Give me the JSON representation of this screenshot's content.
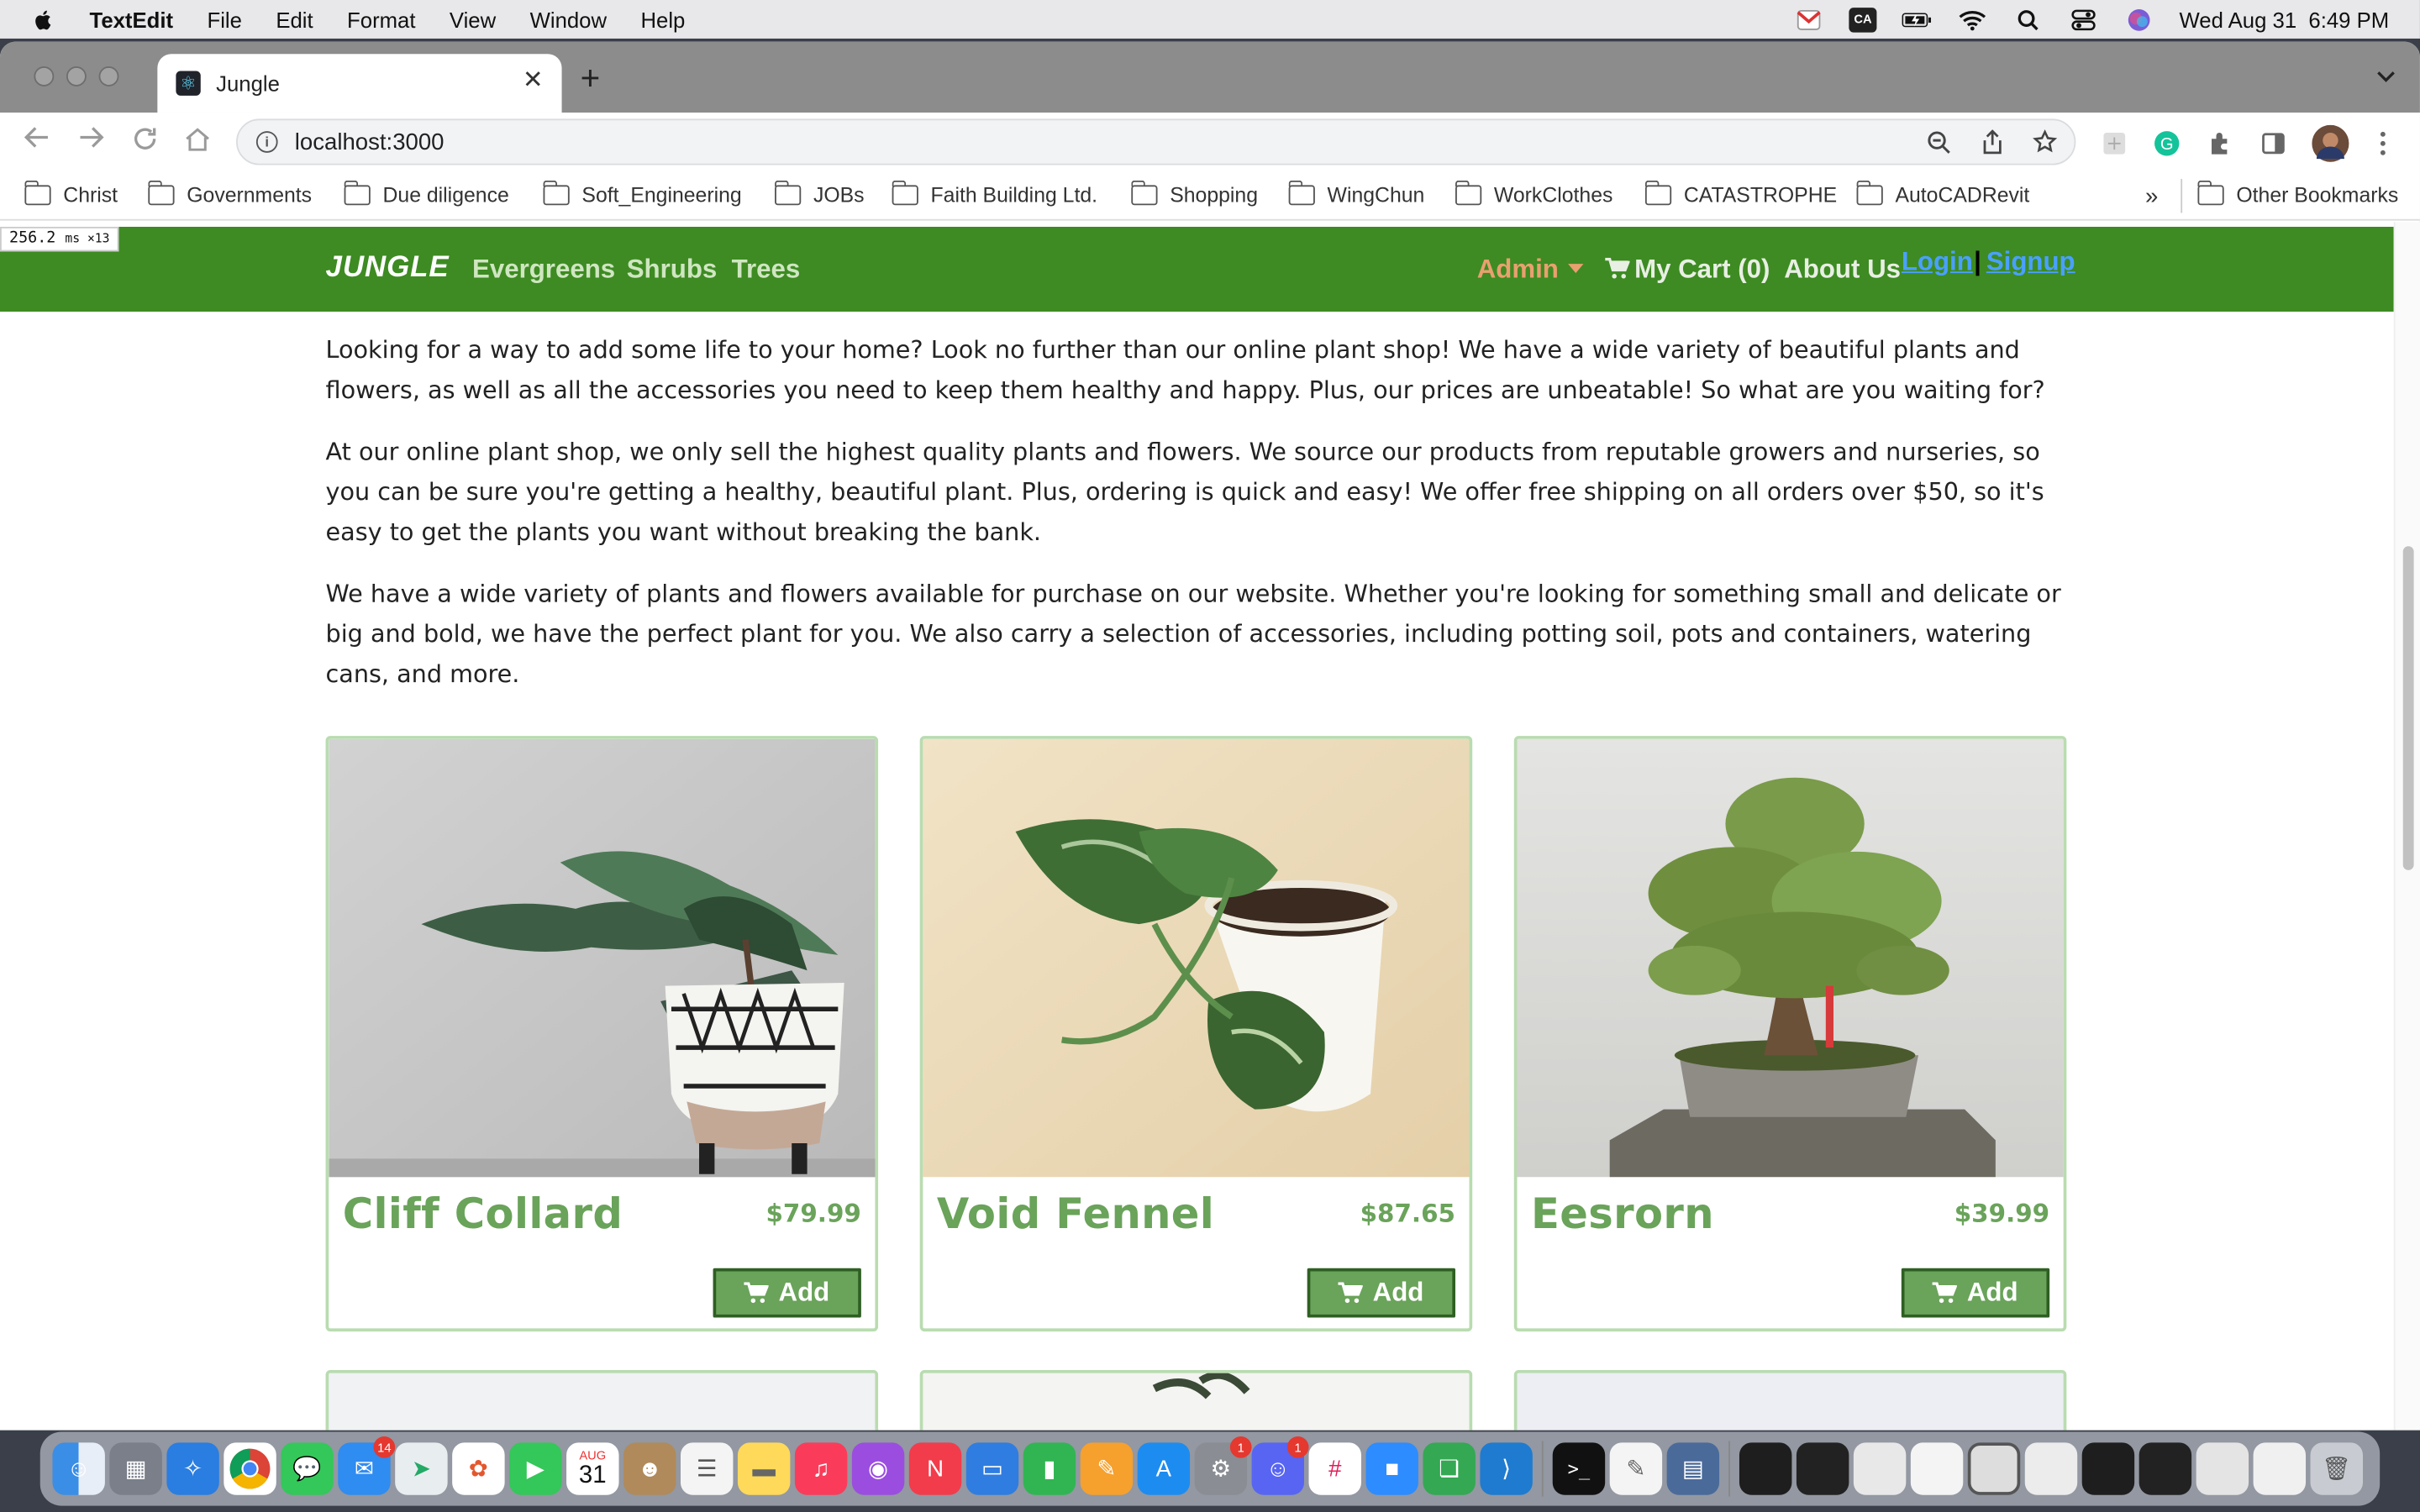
{
  "menubar": {
    "app_name": "TextEdit",
    "items": [
      "File",
      "Edit",
      "Format",
      "View",
      "Window",
      "Help"
    ],
    "status_icons": [
      "gmail-icon",
      "ca-icon",
      "battery-icon",
      "wifi-icon",
      "spotlight-icon",
      "control-center-icon",
      "siri-icon"
    ],
    "ca_label": "CA",
    "clock": "Wed Aug 31  6:49 PM"
  },
  "browser": {
    "tab_title": "Jungle",
    "url": "localhost:3000",
    "bookmarks": [
      "Christ",
      "Governments",
      "Due diligence",
      "Soft_Engineering",
      "JOBs",
      "Faith Building Ltd.",
      "Shopping",
      "WingChun",
      "WorkClothes",
      "CATASTROPHE",
      "AutoCADRevit"
    ],
    "bookmarks_overflow": "»",
    "other_bookmarks": "Other Bookmarks"
  },
  "perf_overlay": {
    "value": "256.2",
    "unit": "ms ×13"
  },
  "site": {
    "brand": "JUNGLE",
    "nav": {
      "evergreens": "Evergreens",
      "shrubs": "Shrubs",
      "trees": "Trees"
    },
    "admin": "Admin",
    "cart": "My Cart (0)",
    "about": "About Us",
    "login": "Login",
    "separator": "|",
    "signup": "Signup",
    "paragraphs": [
      "Looking for a way to add some life to your home? Look no further than our online plant shop! We have a wide variety of beautiful plants and flowers, as well as all the accessories you need to keep them healthy and happy. Plus, our prices are unbeatable! So what are you waiting for?",
      "At our online plant shop, we only sell the highest quality plants and flowers. We source our products from reputable growers and nurseries, so you can be sure you're getting a healthy, beautiful plant. Plus, ordering is quick and easy! We offer free shipping on all orders over $50, so it's easy to get the plants you want without breaking the bank.",
      "We have a wide variety of plants and flowers available for purchase on our website. Whether you're looking for something small and delicate or big and bold, we have the perfect plant for you. We also carry a selection of accessories, including potting soil, pots and containers, watering cans, and more."
    ],
    "products": [
      {
        "name": "Cliff Collard",
        "price": "$79.99",
        "add_label": "Add"
      },
      {
        "name": "Void Fennel",
        "price": "$87.65",
        "add_label": "Add"
      },
      {
        "name": "Eesrorn",
        "price": "$39.99",
        "add_label": "Add"
      }
    ]
  },
  "dock": {
    "mail_badge": "14",
    "calendar_month": "AUG",
    "calendar_day": "31",
    "settings_badge": "1",
    "discord_badge": "1"
  },
  "colors": {
    "navbar": "#3d8b22",
    "product_green": "#6aa35a",
    "admin_orange": "#e9a070",
    "link_blue": "#4aa0ff"
  }
}
